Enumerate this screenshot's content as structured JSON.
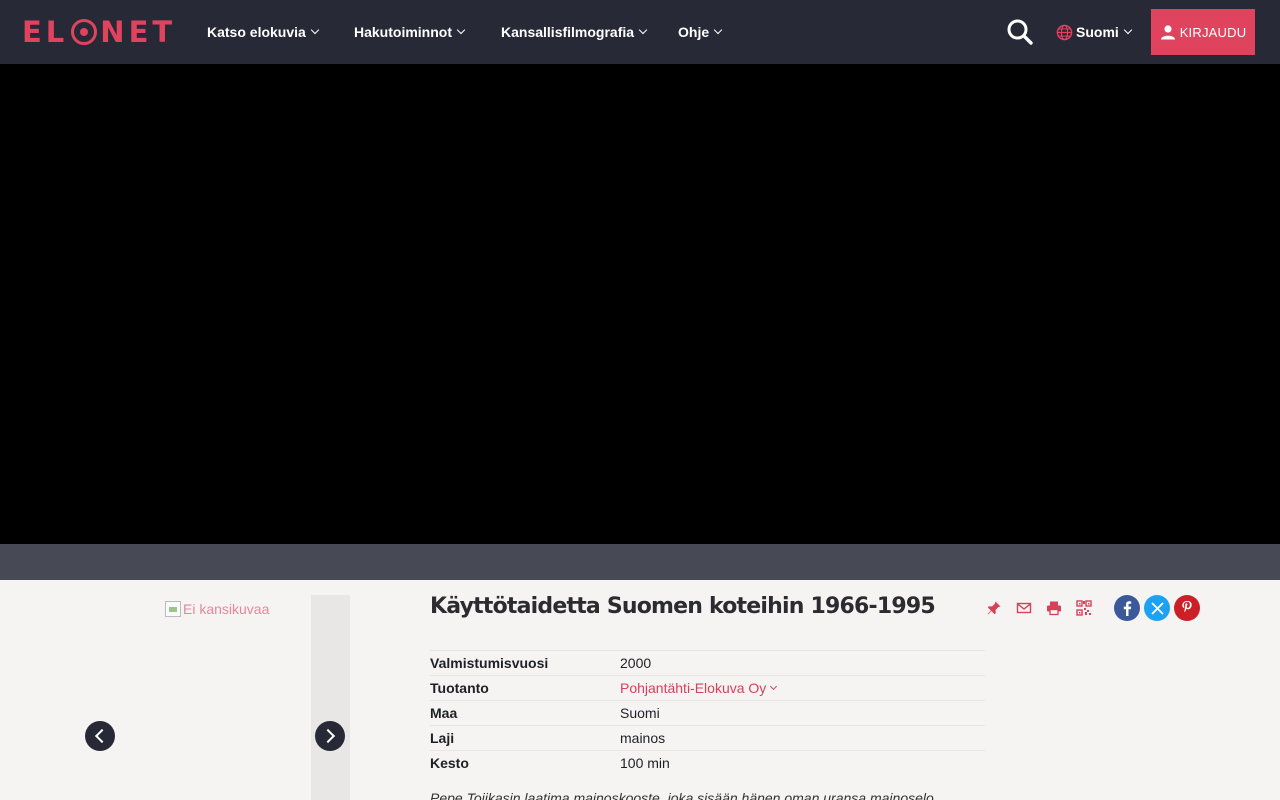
{
  "header": {
    "logo_text": "ELONET",
    "nav": [
      {
        "label": "Katso elokuvia"
      },
      {
        "label": "Hakutoiminnot"
      },
      {
        "label": "Kansallisfilmografia"
      },
      {
        "label": "Ohje"
      }
    ],
    "language": "Suomi",
    "login_label": "KIRJAUDU"
  },
  "colors": {
    "accent": "#e0435d",
    "header_bg": "#272937",
    "video_bg": "#000000",
    "page_bg": "#f5f4f2"
  },
  "film": {
    "cover_alt": "Ei kansikuvaa",
    "title": "Käyttötaidetta Suomen koteihin 1966-1995",
    "details": [
      {
        "key": "Valmistumisvuosi",
        "value": "2000"
      },
      {
        "key": "Tuotanto",
        "value": "Pohjantähti-Elokuva Oy"
      },
      {
        "key": "Maa",
        "value": "Suomi"
      },
      {
        "key": "Laji",
        "value": "mainos"
      },
      {
        "key": "Kesto",
        "value": "100 min"
      }
    ],
    "description": "Pepe Tojikasin laatima mainoskooste, joka sisään hänen oman uransa mainoselo"
  },
  "icons": [
    "pin-icon",
    "mail-icon",
    "print-icon",
    "qr-icon",
    "facebook-icon",
    "x-icon",
    "pinterest-icon",
    "search-icon",
    "globe-icon",
    "user-icon"
  ]
}
